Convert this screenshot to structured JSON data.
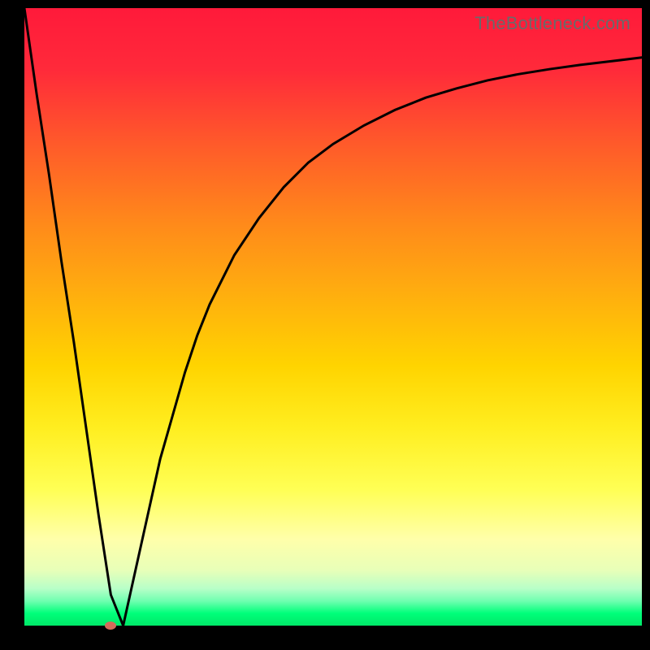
{
  "watermark": "TheBottleneck.com",
  "chart_data": {
    "type": "line",
    "title": "",
    "xlabel": "",
    "ylabel": "",
    "xlim": [
      0,
      100
    ],
    "ylim": [
      0,
      100
    ],
    "grid": false,
    "series": [
      {
        "name": "curve",
        "x": [
          0,
          2,
          4,
          6,
          8,
          10,
          12,
          14,
          16,
          18,
          20,
          22,
          24,
          26,
          28,
          30,
          34,
          38,
          42,
          46,
          50,
          55,
          60,
          65,
          70,
          75,
          80,
          85,
          90,
          95,
          100
        ],
        "values": [
          100,
          86,
          73,
          59,
          46,
          32,
          18,
          5,
          0,
          9,
          18,
          27,
          34,
          41,
          47,
          52,
          60,
          66,
          71,
          75,
          78,
          81,
          83.5,
          85.5,
          87,
          88.3,
          89.3,
          90.1,
          90.8,
          91.4,
          92
        ]
      }
    ],
    "minimum_marker": {
      "x": 14,
      "y": 0,
      "color": "#d46a5a"
    },
    "background_gradient": {
      "orientation": "vertical",
      "stops": [
        {
          "pos": 0.0,
          "color": "#ff1a3a"
        },
        {
          "pos": 0.45,
          "color": "#ffaa10"
        },
        {
          "pos": 0.78,
          "color": "#ffff55"
        },
        {
          "pos": 1.0,
          "color": "#00e868"
        }
      ]
    }
  }
}
